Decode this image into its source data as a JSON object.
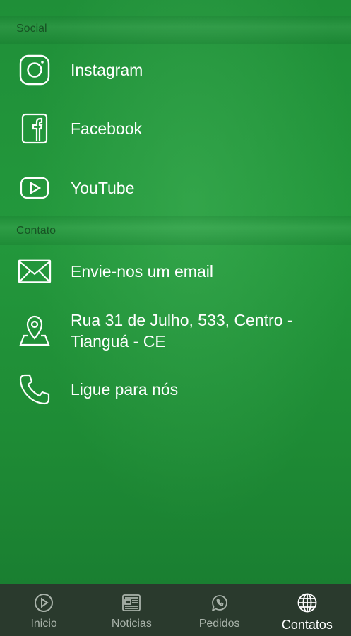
{
  "sections": {
    "social": {
      "header": "Social",
      "items": [
        {
          "label": "Instagram",
          "icon": "instagram-icon"
        },
        {
          "label": "Facebook",
          "icon": "facebook-icon"
        },
        {
          "label": "YouTube",
          "icon": "youtube-icon"
        }
      ]
    },
    "contato": {
      "header": "Contato",
      "items": [
        {
          "label": "Envie-nos um email",
          "icon": "mail-icon"
        },
        {
          "label": "Rua 31 de Julho, 533, Centro - Tianguá - CE",
          "icon": "map-pin-icon"
        },
        {
          "label": "Ligue para nós",
          "icon": "phone-icon"
        }
      ]
    }
  },
  "bottom_nav": {
    "items": [
      {
        "label": "Inicio",
        "icon": "play-circle-icon",
        "active": false
      },
      {
        "label": "Noticias",
        "icon": "newspaper-icon",
        "active": false
      },
      {
        "label": "Pedidos",
        "icon": "whatsapp-icon",
        "active": false
      },
      {
        "label": "Contatos",
        "icon": "globe-icon",
        "active": true
      }
    ]
  },
  "colors": {
    "background": "#1f8c36",
    "nav_background": "#2a3a2d",
    "text": "#ffffff",
    "nav_inactive": "#a9b3aa"
  }
}
